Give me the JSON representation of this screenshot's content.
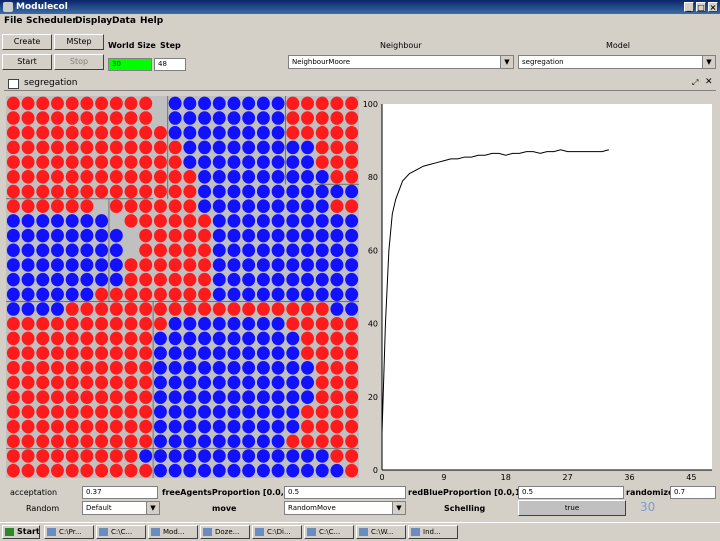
{
  "window": {
    "title": "Modulecol",
    "icon": "app-icon"
  },
  "menu": [
    "File",
    "Scheduler",
    "Display",
    "Data",
    "Help"
  ],
  "toolbar": {
    "create": "Create",
    "mstep": "MStep",
    "start": "Start",
    "stop": "Stop",
    "world_size_label": "World Size",
    "step_label": "Step",
    "world_size_value": "30",
    "step_value": "48",
    "neighbour_label": "Neighbour",
    "neighbour_value": "NeighbourMoore",
    "model_label": "Model",
    "model_value": "segregation"
  },
  "panel": {
    "title": "segregation"
  },
  "grid": {
    "cols": 24,
    "rows": 26,
    "colors": {
      "red": "#ff1b1b",
      "blue": "#1111ff",
      "empty": "#c0c0c0"
    },
    "rows_data": [
      "rrrrrrrrrr.bbbbbbbbrrrrr",
      "rrrrrrrrrr.bbbbbbbbrrrrr",
      "rrrrrrrrrrrbbbbbbbbrrrrr",
      "rrrrrrrrrrrrbbbbbbbbbrrr",
      "rrrrrrrrrrrrbbbbbbbbbrrr",
      "rrrrrrrrrrrrrbbbbbbbbbrr",
      "rrrrrrrrrrrrrbbbbbbbbbbb",
      "rrrrrr.rrrrrrbbbbbbbbbrr",
      "bbbbbbb.rrrrrrbbbbbbbbbb",
      "bbbbbbbb.rrrrrbbbbbbbbbb",
      "bbbbbbbb.rrrrrbbbbbbbbbb",
      "bbbbbbbbrrrrrrbbbbbbbbbb",
      "bbbbbbbbrrrrrrbbbbbbbbbb",
      "bbbbbbrrrrrrrrbbbbbbbbbb",
      "bbbbrrrrrrrrrrrrrrrrrrbb",
      "rrrrrrrrrrrbbbbbbbbrrrrr",
      "rrrrrrrrrrbbbbbbbbbbrrrr",
      "rrrrrrrrrrbbbbbbbbbbrrrr",
      "rrrrrrrrrrbbbbbbbbbbbrrr",
      "rrrrrrrrrrbbbbbbbbbbbrrr",
      "rrrrrrrrrrbbbbbbbbbbbrrr",
      "rrrrrrrrrrbbbbbbbbbbrrrr",
      "rrrrrrrrrrbbbbbbbbbbrrrr",
      "rrrrrrrrrrbbbbbbbbbrrrrr",
      "rrrrrrrrrbbbbbbbbbbbbbrr",
      "rrrrrrrrrrbbbbbbbbbbbbbr"
    ]
  },
  "chart_data": {
    "type": "line",
    "xlim": [
      0,
      48
    ],
    "ylim": [
      0,
      100
    ],
    "x_ticks": [
      "0",
      "9",
      "18",
      "27",
      "36",
      "45"
    ],
    "y_ticks": [
      "0",
      "20",
      "40",
      "60",
      "80",
      "100"
    ],
    "series": [
      {
        "x": [
          0,
          0.5,
          1,
          1.5,
          2,
          3,
          4,
          5,
          6,
          7,
          8,
          9,
          10,
          11,
          12,
          13,
          14,
          15,
          16,
          17,
          18,
          19,
          20,
          21,
          22,
          23,
          24,
          25,
          26,
          27,
          28,
          29,
          30,
          31,
          32,
          33
        ],
        "y": [
          10,
          40,
          60,
          70,
          74,
          79,
          81,
          82,
          83,
          83.5,
          84,
          84.5,
          85,
          85,
          85.5,
          85.5,
          86,
          86,
          86.5,
          86.5,
          86,
          86.5,
          86.5,
          87,
          87,
          86.5,
          87,
          87,
          87.5,
          87,
          87,
          87,
          87,
          87,
          87,
          87.5
        ]
      }
    ],
    "color": "#000000"
  },
  "bottom": {
    "acceptation_label": "acceptation",
    "acceptation_value": "0.37",
    "freeAgents_label": "freeAgentsProportion [0.0,1.0]",
    "freeAgents_value": "0.5",
    "redBlue_label": "redBlueProportion [0.0,1.0]",
    "redBlue_value": "0.5",
    "randomize_label": "randomize",
    "randomize_value": "0.7",
    "random_label": "Random",
    "random_value": "Default",
    "move_label": "move",
    "move_value": "RandomMove",
    "schelling_label": "Schelling",
    "schelling_value": "true",
    "page_number": "30"
  },
  "taskbar": {
    "start": "Start",
    "tasks": [
      "C:\\Pr...",
      "C:\\C...",
      "Mod...",
      "Doze...",
      "C:\\Di...",
      "C:\\C...",
      "C:\\W...",
      "Ind..."
    ]
  }
}
